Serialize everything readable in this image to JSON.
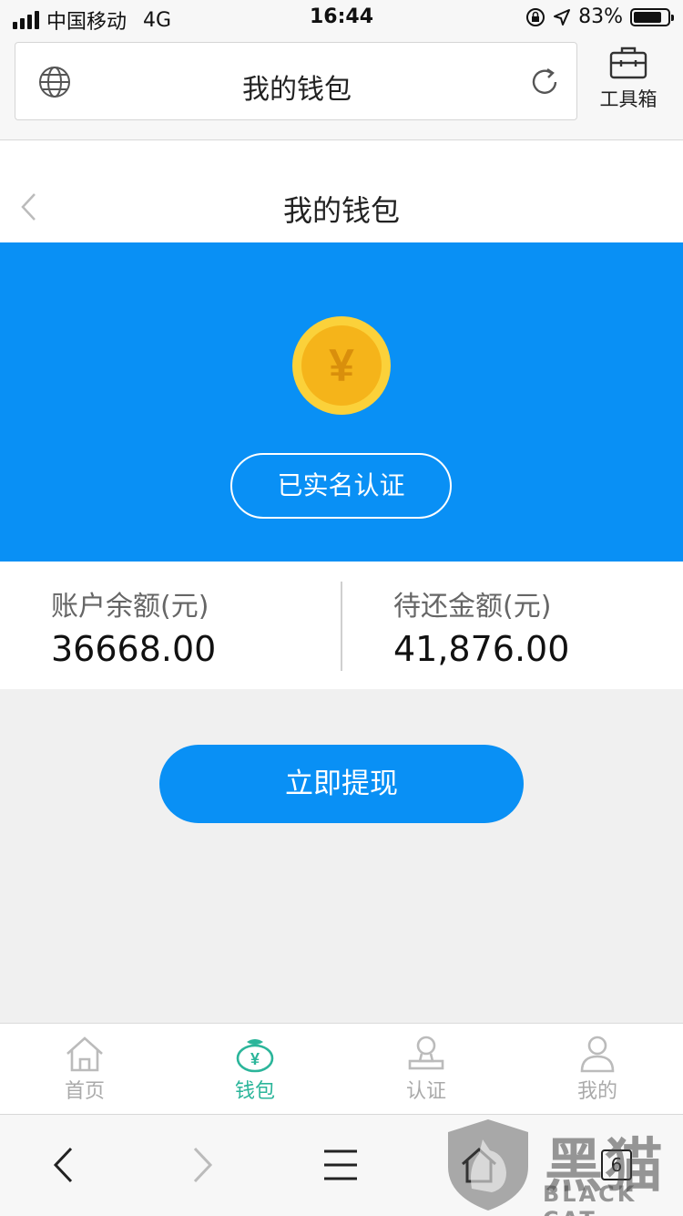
{
  "status_bar": {
    "carrier": "中国移动",
    "network": "4G",
    "time": "16:44",
    "battery": "83%",
    "battery_level": 0.83
  },
  "browser": {
    "title": "我的钱包",
    "toolbox_label": "工具箱",
    "tab_count": "6"
  },
  "header": {
    "title": "我的钱包"
  },
  "hero": {
    "coin_symbol": "¥",
    "verified_label": "已实名认证"
  },
  "amounts": {
    "balance_label": "账户余额(元)",
    "balance_value": "36668.00",
    "due_label": "待还金额(元)",
    "due_value": "41,876.00"
  },
  "withdraw_label": "立即提现",
  "tabs": [
    {
      "label": "首页",
      "icon": "home-icon"
    },
    {
      "label": "钱包",
      "icon": "wallet-icon"
    },
    {
      "label": "认证",
      "icon": "verification-icon"
    },
    {
      "label": "我的",
      "icon": "profile-icon"
    }
  ],
  "watermark": {
    "cn": "黑猫",
    "en": "BLACK CAT"
  },
  "colors": {
    "primary": "#0990f5",
    "active_tab": "#2bb59a",
    "coin": "#f5b41a"
  }
}
